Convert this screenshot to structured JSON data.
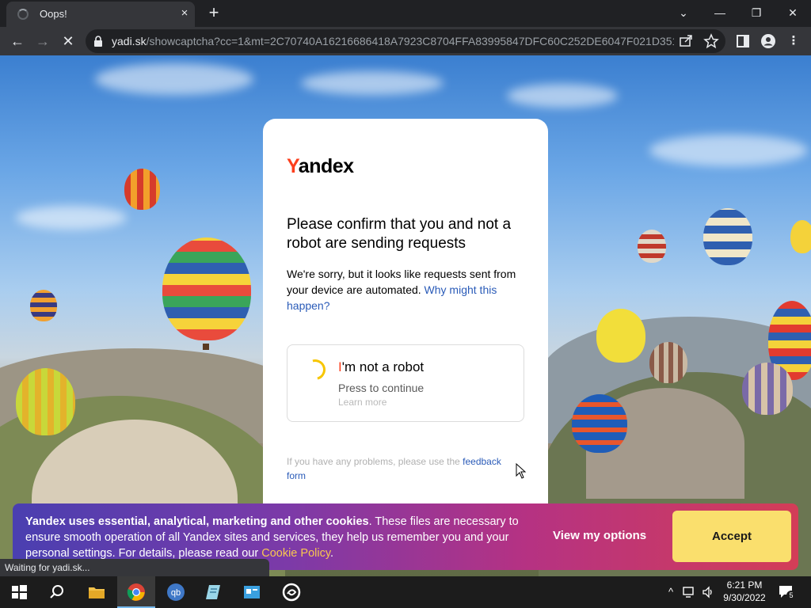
{
  "browser": {
    "tab": {
      "title": "Oops!",
      "close_icon": "×"
    },
    "new_tab_icon": "+",
    "window_controls": {
      "tab_search": "⌄",
      "minimize": "—",
      "restore": "❐",
      "close": "✕"
    },
    "nav": {
      "back": "←",
      "forward": "→",
      "reload": "✕"
    },
    "url_host": "yadi.sk",
    "url_path": "/showcaptcha?cc=1&mt=2C70740A16216686418A7923C8704FFA83995847DFC60C252DE6047F021D351..."
  },
  "captcha": {
    "logo_first": "Y",
    "logo_rest": "andex",
    "heading": "Please confirm that you and not a robot are sending requests",
    "desc_text": "We're sorry, but it looks like requests sent from your device are automated.",
    "desc_link": "Why might this happen?",
    "robot_title_first": "I",
    "robot_title_rest": "'m not a robot",
    "robot_sub": "Press to continue",
    "robot_learn": "Learn more",
    "feedback_text": "If you have any problems, please use the",
    "feedback_link": "feedback form"
  },
  "cookie": {
    "bold": "Yandex uses essential, analytical, marketing and other cookies",
    "text": ". These files are necessary to ensure smooth operation of all Yandex sites and services, they help us remember you and your personal settings. For details, please read our ",
    "link": "Cookie Policy",
    "end": ".",
    "options": "View my options",
    "accept": "Accept"
  },
  "status": "Waiting for yadi.sk...",
  "taskbar": {
    "time": "6:21 PM",
    "date": "9/30/2022",
    "notifications": "5"
  },
  "colors": {
    "yandex_red": "#fc3f1d",
    "link_blue": "#2a5bb8",
    "accept_yellow": "#fadf6d"
  }
}
